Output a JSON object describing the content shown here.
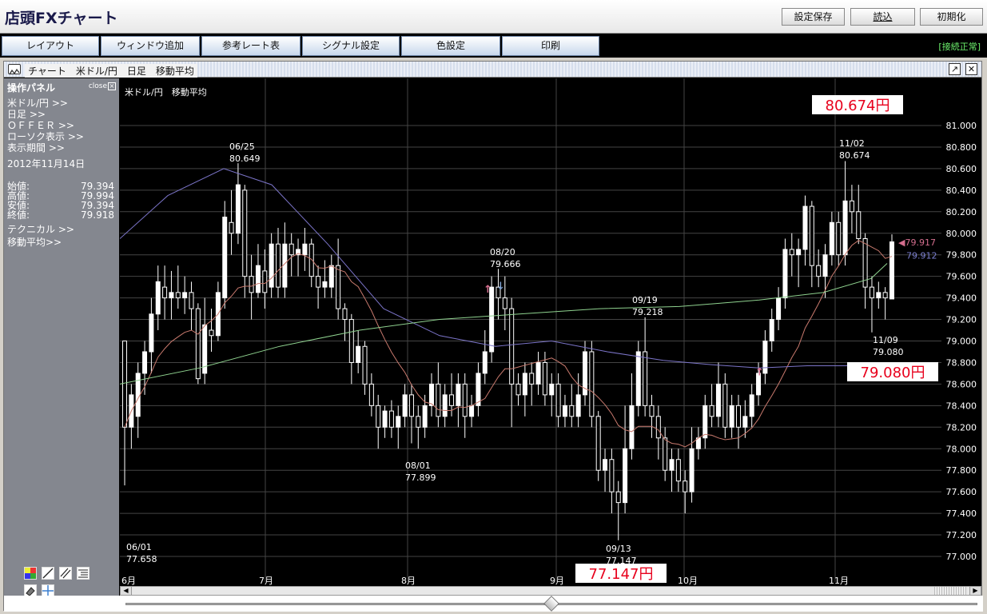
{
  "app": {
    "title": "店頭FXチャート"
  },
  "toolbar": {
    "settings_save": "設定保存",
    "load": "読込",
    "reset": "初期化"
  },
  "menu": {
    "items": [
      "レイアウト",
      "ウィンドウ追加",
      "参考レート表",
      "シグナル設定",
      "色設定",
      "印刷"
    ],
    "status": "[接続正常]"
  },
  "chart_window": {
    "title": "チャート　米ドル/円　日足　移動平均",
    "chart_label": "米ドル/円　移動平均"
  },
  "panel": {
    "title": "操作パネル",
    "close": "close",
    "links": [
      "米ドル/円 >>",
      "日足 >>",
      "ＯＦＦＥＲ >>",
      "ローソク表示 >>",
      "表示期間 >>"
    ],
    "date": "2012年11月14日",
    "ohlc": [
      {
        "label": "始値:",
        "value": "79.394"
      },
      {
        "label": "高値:",
        "value": "79.994"
      },
      {
        "label": "安値:",
        "value": "79.394"
      },
      {
        "label": "終値:",
        "value": "79.918"
      }
    ],
    "technical": "テクニカル >>",
    "ma": "移動平均>>"
  },
  "colors": {
    "background": "#000000",
    "grid": "#444444",
    "candle": "#ffffff",
    "ma_short": "#c97a6e",
    "ma_mid": "#7b74c8",
    "ma_long": "#8fd28f",
    "badge_text": "#e8001c",
    "ask_marker": "#d46e8e",
    "bid_marker": "#7b7fd0"
  },
  "chart_data": {
    "type": "candlestick",
    "ylim": [
      76.9,
      81.1
    ],
    "y_ticks": [
      "81.000",
      "80.800",
      "80.600",
      "80.400",
      "80.200",
      "80.000",
      "79.800",
      "79.600",
      "79.400",
      "79.200",
      "79.000",
      "78.800",
      "78.600",
      "78.400",
      "78.200",
      "78.000",
      "77.800",
      "77.600",
      "77.400",
      "77.200",
      "77.000"
    ],
    "x_ticks": [
      "6月",
      "7月",
      "8月",
      "9月",
      "10月",
      "11月"
    ],
    "annotations": [
      {
        "date": "06/01",
        "value": "77.658"
      },
      {
        "date": "06/25",
        "value": "80.649"
      },
      {
        "date": "08/01",
        "value": "77.899"
      },
      {
        "date": "08/20",
        "value": "79.666"
      },
      {
        "date": "09/13",
        "value": "77.147"
      },
      {
        "date": "09/19",
        "value": "79.218"
      },
      {
        "date": "11/02",
        "value": "80.674"
      },
      {
        "date": "11/09",
        "value": "79.080"
      }
    ],
    "badges": [
      "80.674円",
      "79.080円",
      "77.147円"
    ],
    "current_ask": "79.917",
    "current_bid": "79.912",
    "ma_long_start": 78.6,
    "ma_long_end": 79.7,
    "candles_note": "daily OHLC approximated",
    "candles": [
      [
        79.0,
        78.2,
        79.0,
        77.66
      ],
      [
        78.2,
        78.5,
        78.6,
        78.0
      ],
      [
        78.3,
        78.7,
        78.8,
        78.1
      ],
      [
        78.7,
        78.9,
        79.0,
        78.5
      ],
      [
        78.9,
        79.25,
        79.4,
        78.7
      ],
      [
        79.25,
        79.55,
        79.7,
        79.1
      ],
      [
        79.5,
        79.4,
        79.7,
        79.2
      ],
      [
        79.4,
        79.45,
        79.65,
        79.2
      ],
      [
        79.45,
        79.4,
        79.7,
        79.3
      ],
      [
        79.4,
        79.45,
        79.6,
        79.25
      ],
      [
        79.45,
        79.3,
        79.55,
        79.1
      ],
      [
        79.3,
        78.65,
        79.35,
        78.6
      ],
      [
        78.7,
        79.15,
        79.4,
        78.6
      ],
      [
        79.1,
        79.05,
        79.3,
        78.9
      ],
      [
        79.05,
        79.45,
        79.55,
        79.0
      ],
      [
        79.4,
        80.15,
        80.3,
        79.3
      ],
      [
        80.1,
        80.0,
        80.4,
        79.8
      ],
      [
        80.0,
        80.45,
        80.65,
        79.9
      ],
      [
        80.4,
        79.6,
        80.45,
        79.4
      ],
      [
        79.6,
        79.45,
        79.8,
        79.2
      ],
      [
        79.45,
        79.7,
        79.9,
        79.4
      ],
      [
        79.65,
        79.45,
        79.85,
        79.3
      ],
      [
        79.5,
        79.9,
        80.0,
        79.4
      ],
      [
        79.9,
        79.5,
        80.05,
        79.4
      ],
      [
        79.5,
        79.9,
        80.1,
        79.4
      ],
      [
        79.9,
        79.8,
        80.0,
        79.6
      ],
      [
        79.8,
        79.85,
        79.95,
        79.6
      ],
      [
        79.8,
        79.9,
        80.05,
        79.65
      ],
      [
        79.9,
        79.6,
        79.95,
        79.5
      ],
      [
        79.6,
        79.5,
        79.7,
        79.3
      ],
      [
        79.5,
        79.55,
        79.75,
        79.4
      ],
      [
        79.5,
        79.7,
        79.8,
        79.4
      ],
      [
        79.7,
        79.3,
        79.95,
        79.2
      ],
      [
        79.3,
        79.2,
        79.35,
        79.0
      ],
      [
        79.2,
        78.8,
        79.25,
        78.6
      ],
      [
        78.8,
        78.95,
        79.1,
        78.7
      ],
      [
        78.95,
        78.6,
        79.0,
        78.5
      ],
      [
        78.6,
        78.4,
        78.7,
        78.3
      ],
      [
        78.4,
        78.2,
        78.5,
        78.0
      ],
      [
        78.2,
        78.35,
        78.4,
        78.1
      ],
      [
        78.35,
        78.2,
        78.45,
        78.1
      ],
      [
        78.2,
        78.3,
        78.4,
        78.0
      ],
      [
        78.3,
        78.5,
        78.6,
        78.2
      ],
      [
        78.5,
        78.3,
        78.6,
        78.05
      ],
      [
        78.3,
        78.2,
        78.4,
        78.0
      ],
      [
        78.2,
        78.4,
        78.5,
        78.1
      ],
      [
        78.4,
        78.6,
        78.7,
        78.3
      ],
      [
        78.6,
        78.3,
        78.8,
        78.2
      ],
      [
        78.3,
        78.5,
        78.6,
        78.2
      ],
      [
        78.5,
        78.4,
        78.7,
        78.3
      ],
      [
        78.4,
        78.6,
        78.7,
        78.2
      ],
      [
        78.6,
        78.3,
        78.7,
        78.1
      ],
      [
        78.3,
        78.4,
        78.5,
        78.2
      ],
      [
        78.4,
        78.7,
        78.8,
        78.3
      ],
      [
        78.7,
        78.9,
        79.1,
        78.6
      ],
      [
        78.9,
        79.5,
        79.6,
        78.8
      ],
      [
        79.5,
        79.4,
        79.67,
        79.2
      ],
      [
        79.4,
        79.3,
        79.6,
        79.1
      ],
      [
        79.3,
        78.6,
        79.4,
        78.2
      ],
      [
        78.6,
        78.5,
        78.7,
        78.4
      ],
      [
        78.5,
        78.7,
        78.8,
        78.3
      ],
      [
        78.7,
        78.6,
        78.8,
        78.4
      ],
      [
        78.6,
        78.8,
        78.9,
        78.5
      ],
      [
        78.8,
        78.5,
        78.9,
        78.4
      ],
      [
        78.5,
        78.6,
        78.7,
        78.3
      ],
      [
        78.6,
        78.3,
        78.7,
        78.2
      ],
      [
        78.3,
        78.4,
        78.5,
        78.2
      ],
      [
        78.4,
        78.3,
        78.6,
        78.2
      ],
      [
        78.3,
        78.5,
        78.7,
        78.2
      ],
      [
        78.5,
        78.9,
        79.0,
        78.4
      ],
      [
        78.9,
        78.3,
        79.0,
        78.2
      ],
      [
        78.3,
        77.8,
        78.35,
        77.7
      ],
      [
        77.8,
        77.9,
        78.0,
        77.6
      ],
      [
        77.9,
        77.6,
        78.0,
        77.4
      ],
      [
        77.6,
        77.5,
        77.7,
        77.15
      ],
      [
        77.5,
        78.0,
        78.4,
        77.4
      ],
      [
        78.0,
        78.4,
        78.7,
        77.9
      ],
      [
        78.4,
        78.9,
        79.0,
        78.3
      ],
      [
        78.9,
        78.4,
        79.22,
        78.3
      ],
      [
        78.4,
        78.3,
        78.5,
        78.1
      ],
      [
        78.3,
        78.1,
        78.4,
        77.9
      ],
      [
        78.1,
        77.8,
        78.2,
        77.7
      ],
      [
        77.8,
        77.9,
        78.0,
        77.6
      ],
      [
        77.9,
        77.7,
        78.0,
        77.6
      ],
      [
        77.7,
        77.6,
        77.8,
        77.4
      ],
      [
        77.6,
        78.0,
        78.2,
        77.5
      ],
      [
        78.0,
        78.1,
        78.2,
        77.9
      ],
      [
        78.1,
        78.4,
        78.5,
        78.0
      ],
      [
        78.4,
        78.3,
        78.6,
        78.2
      ],
      [
        78.3,
        78.6,
        78.8,
        78.2
      ],
      [
        78.6,
        78.2,
        78.7,
        78.1
      ],
      [
        78.2,
        78.4,
        78.5,
        78.1
      ],
      [
        78.4,
        78.2,
        78.5,
        78.0
      ],
      [
        78.2,
        78.3,
        78.45,
        78.1
      ],
      [
        78.3,
        78.5,
        78.6,
        78.2
      ],
      [
        78.5,
        78.7,
        78.8,
        78.4
      ],
      [
        78.7,
        79.0,
        79.1,
        78.6
      ],
      [
        79.0,
        79.2,
        79.3,
        78.9
      ],
      [
        79.2,
        79.4,
        79.5,
        79.1
      ],
      [
        79.4,
        79.85,
        79.95,
        79.3
      ],
      [
        79.85,
        79.8,
        80.0,
        79.6
      ],
      [
        79.8,
        79.85,
        79.95,
        79.5
      ],
      [
        79.85,
        80.25,
        80.35,
        79.7
      ],
      [
        80.25,
        79.7,
        80.3,
        79.5
      ],
      [
        79.7,
        79.6,
        79.85,
        79.5
      ],
      [
        79.6,
        79.8,
        79.9,
        79.4
      ],
      [
        79.8,
        80.1,
        80.2,
        79.7
      ],
      [
        80.1,
        79.8,
        80.2,
        79.7
      ],
      [
        79.8,
        80.3,
        80.67,
        79.7
      ],
      [
        80.3,
        80.2,
        80.45,
        80.0
      ],
      [
        80.2,
        79.95,
        80.45,
        79.9
      ],
      [
        79.95,
        79.5,
        80.0,
        79.3
      ],
      [
        79.5,
        79.4,
        79.6,
        79.08
      ],
      [
        79.4,
        79.45,
        79.55,
        79.3
      ],
      [
        79.45,
        79.4,
        79.5,
        79.2
      ],
      [
        79.39,
        79.92,
        79.99,
        79.39
      ]
    ]
  }
}
